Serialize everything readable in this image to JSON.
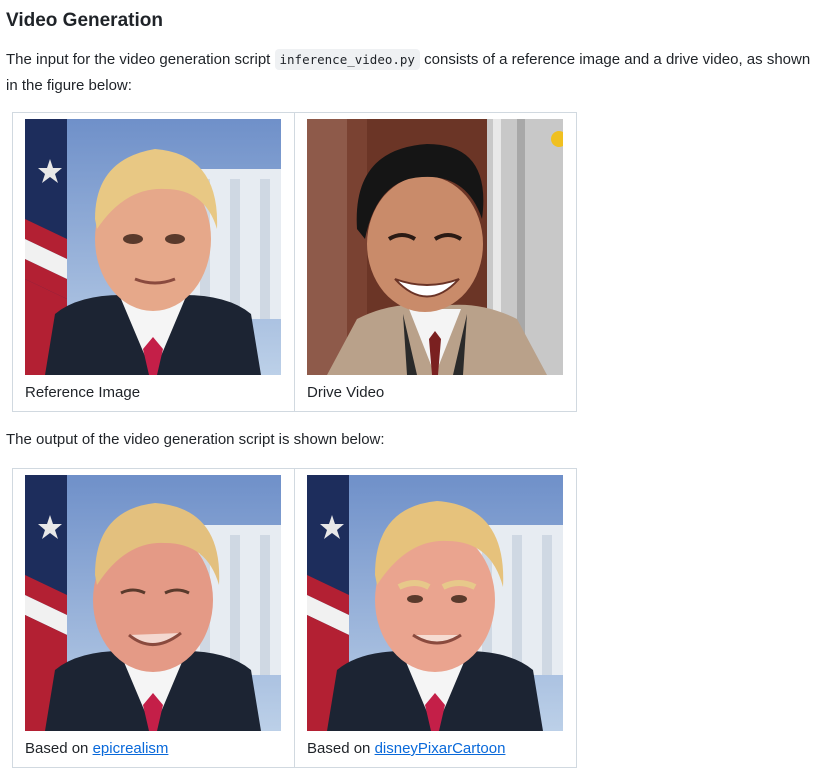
{
  "heading": "Video Generation",
  "intro": {
    "before": "The input for the video generation script ",
    "code": "inference_video.py",
    "after": " consists of a reference image and a drive video, as shown in the figure below:"
  },
  "inputs": {
    "reference_caption": "Reference Image",
    "drive_caption": "Drive Video"
  },
  "output_intro": "The output of the video generation script is shown below:",
  "outputs": {
    "left_prefix": "Based on ",
    "left_link": "epicrealism",
    "right_prefix": "Based on ",
    "right_link": "disneyPixarCartoon"
  },
  "colors": {
    "link": "#0969da",
    "border": "#d1d9e0"
  }
}
